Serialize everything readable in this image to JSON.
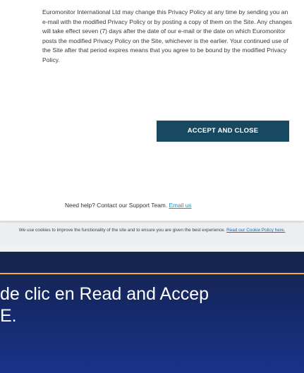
{
  "modal": {
    "policy_lines": "Euromonitor International Ltd may change this Privacy Policy at any time by sending you an e-mail with the modified Privacy Policy or by posting a copy of them on the Site. Any changes will take effect seven (7) days after the date of our e-mail or the date on which Euromonitor posts the modified Privacy Policy on the Site, whichever is the earlier. Your continued use of the Site after that period expires means that you agree to be bound by the modified Privacy Policy.",
    "accept_button_label": "ACCEPT AND CLOSE",
    "support_text": "Need help? Contact our Support Team.",
    "support_link_label": "Email us"
  },
  "cookie_bar": {
    "text": "We use cookies to improve the functionality of the site and to ensure you are given the best experience.",
    "link_label": "Read our Cookie Policy here."
  },
  "slide": {
    "line_1": "de clic en Read and Accep",
    "line_2": "E."
  },
  "colors": {
    "accept_button": "#174a60",
    "link": "#1a8fc8",
    "slide_background": "#152968",
    "accent_line": "#e7b22c"
  }
}
